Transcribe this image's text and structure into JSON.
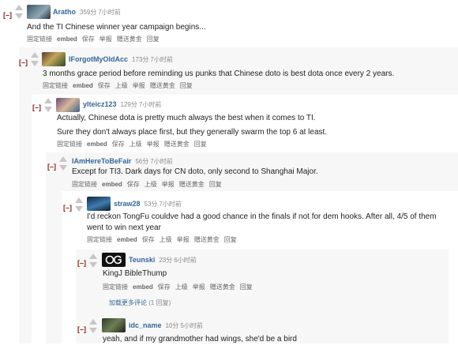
{
  "collapse_symbol": "[–]",
  "actions": {
    "permalink": "固定链接",
    "embed": "embed",
    "save": "保存",
    "parent": "上级",
    "report": "举报",
    "gild": "赠送黄金",
    "reply": "回复"
  },
  "comments": [
    {
      "author": "Aratho",
      "score": "359分",
      "time": "7小时前",
      "body": [
        "And the TI Chinese winner year campaign begins..."
      ]
    },
    {
      "author": "IForgotMyOldAcc",
      "score": "173分",
      "time": "7小时前",
      "body": [
        "3 months grace period before reminding us punks that Chinese doto is best dota once every 2 years."
      ]
    },
    {
      "author": "ylteicz123",
      "score": "129分",
      "time": "7小时前",
      "body": [
        "Actually, Chinese dota is pretty much always the best when it comes to TI.",
        "Sure they don't always place first, but they generally swarm the top 6 at least."
      ]
    },
    {
      "author": "IAmHereToBeFair",
      "score": "56分",
      "time": "7小时前",
      "body": [
        "Except for TI3. Dark days for CN doto, only second to Shanghai Major."
      ]
    },
    {
      "author": "straw28",
      "score": "53分",
      "time": "7小时前",
      "body": [
        "I'd reckon TongFu couldve had a good chance in the finals if not for dem hooks. After all, 4/5 of them went to win next year"
      ]
    },
    {
      "author": "Teunski",
      "score": "23分",
      "time": "6小时前",
      "body": [
        "KingJ BibleThump"
      ]
    },
    {
      "author": "idc_name",
      "score": "10分",
      "time": "5小时前",
      "body": [
        "yeah, and if my grandmother had wings, she'd be a bird"
      ]
    }
  ],
  "load_more": {
    "label": "加载更多评论",
    "count": "(1 回复)"
  },
  "colors": {
    "author": "#336699",
    "collapse": "#8f1d1d",
    "nested_bg": "#f7f7f8"
  }
}
